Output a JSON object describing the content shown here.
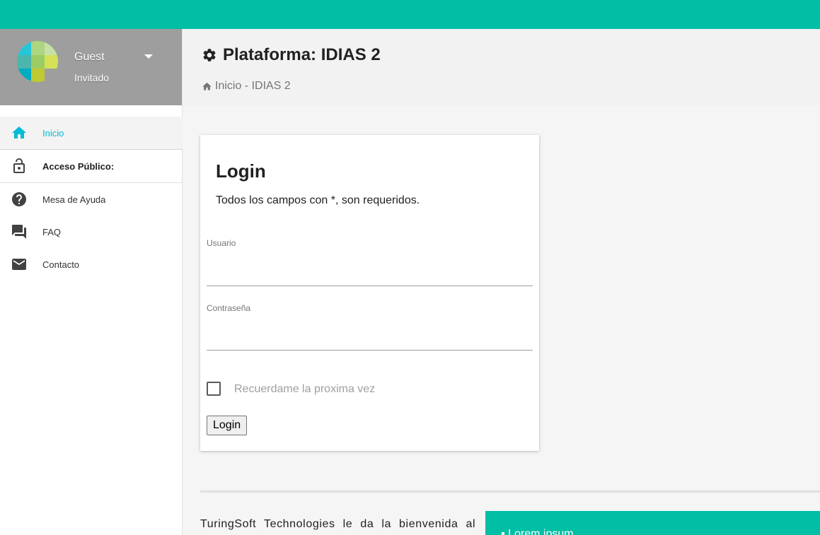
{
  "colors": {
    "topbar": "#00bfa5",
    "accent": "#00bcd4",
    "profile_bg": "#9e9e9e"
  },
  "profile": {
    "name": "Guest",
    "role": "Invitado",
    "avatar_icon": "mosaic-avatar-icon",
    "menu_icon": "caret-down-icon"
  },
  "sidebar": {
    "items": [
      {
        "label": "Inicio",
        "icon": "home-icon",
        "active": true
      },
      {
        "label": "Acceso Público:",
        "icon": "lock-open-icon",
        "section": true
      },
      {
        "label": "Mesa de Ayuda",
        "icon": "help-circle-icon"
      },
      {
        "label": "FAQ",
        "icon": "forum-icon"
      },
      {
        "label": "Contacto",
        "icon": "mail-icon"
      }
    ]
  },
  "header": {
    "title": "Plataforma: IDIAS 2",
    "title_icon": "gear-icon",
    "breadcrumb": "Inicio - IDIAS 2",
    "breadcrumb_icon": "home-icon"
  },
  "login": {
    "title": "Login",
    "subtitle": "Todos los campos con *, son requeridos.",
    "username_label": "Usuario",
    "username_value": "",
    "password_label": "Contraseña",
    "password_value": "",
    "remember_label": "Recuerdame la proxima vez",
    "remember_checked": false,
    "submit_label": "Login"
  },
  "footer": {
    "welcome_text": "TuringSoft Technologies le da la bienvenida al",
    "panel_text": "▪ Lorem ipsum"
  }
}
